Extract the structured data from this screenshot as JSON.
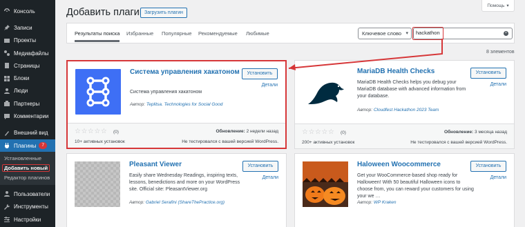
{
  "sidebar": {
    "items": [
      {
        "label": "Консоль",
        "icon": "dashboard-icon"
      },
      {
        "label": "Записи",
        "icon": "pin-icon"
      },
      {
        "label": "Проекты",
        "icon": "projects-icon"
      },
      {
        "label": "Медиафайлы",
        "icon": "media-icon"
      },
      {
        "label": "Страницы",
        "icon": "pages-icon"
      },
      {
        "label": "Блоки",
        "icon": "blocks-icon"
      },
      {
        "label": "Люди",
        "icon": "people-icon"
      },
      {
        "label": "Партнеры",
        "icon": "partners-icon"
      },
      {
        "label": "Комментарии",
        "icon": "comments-icon"
      },
      {
        "label": "Внешний вид",
        "icon": "appearance-icon"
      },
      {
        "label": "Плагины",
        "icon": "plugins-icon",
        "badge": "7"
      },
      {
        "label": "Пользователи",
        "icon": "users-icon"
      },
      {
        "label": "Инструменты",
        "icon": "tools-icon"
      },
      {
        "label": "Настройки",
        "icon": "settings-icon"
      }
    ],
    "submenu": [
      "Установленные",
      "Добавить новый",
      "Редактор плагинов"
    ]
  },
  "header": {
    "title": "Добавить плагины",
    "upload_label": "Загрузить плагин",
    "help_label": "Помощь"
  },
  "filter": {
    "tabs": [
      "Результаты поиска",
      "Избранные",
      "Популярные",
      "Рекомендуемые",
      "Любимые"
    ],
    "search_type": "Ключевое слово",
    "search_value": "hackathon"
  },
  "results_count": "8 элементов",
  "cards": [
    {
      "name": "Система управления хакатоном",
      "description": "Система управления хакатоном",
      "author_prefix": "Автор:",
      "author": "Teplitsa. Technologies for Social Good",
      "install": "Установить",
      "details": "Детали",
      "rating_count": "(0)",
      "installs": "10+ активных установок",
      "updated_label": "Обновление:",
      "updated": "2 недели назад",
      "compat": "Не тестировался с вашей версией WordPress."
    },
    {
      "name": "MariaDB Health Checks",
      "description": "MariaDB Health Checks helps you debug your MariaDB database with advanced information from your database.",
      "author_prefix": "Автор:",
      "author": "Cloudfest Hackathon 2023 Team",
      "install": "Установить",
      "details": "Детали",
      "rating_count": "(0)",
      "installs": "200+ активных установок",
      "updated_label": "Обновление:",
      "updated": "3 месяца назад",
      "compat": "Не тестировался с вашей версией WordPress."
    },
    {
      "name": "Pleasant Viewer",
      "description": "Easily share Wednesday Readings, inspiring texts, lessons, benedictions and more on your WordPress site. Official site: PleasantViewer.org",
      "author_prefix": "Автор:",
      "author": "Gabriel Serafini (ShareThePractice.org)",
      "install": "Установить",
      "details": "Детали"
    },
    {
      "name": "Haloween Woocommerce",
      "description": "Get your WooCommerce-based shop ready for Halloween! With 50 beautiful Halloween icons to choose from, you can reward your customers for using your we …",
      "author_prefix": "Автор:",
      "author": "WP Kraken",
      "install": "Установить",
      "details": "Детали"
    }
  ],
  "colors": {
    "accent": "#2271b1",
    "sidebar": "#1d2327",
    "highlight": "#d63638"
  }
}
